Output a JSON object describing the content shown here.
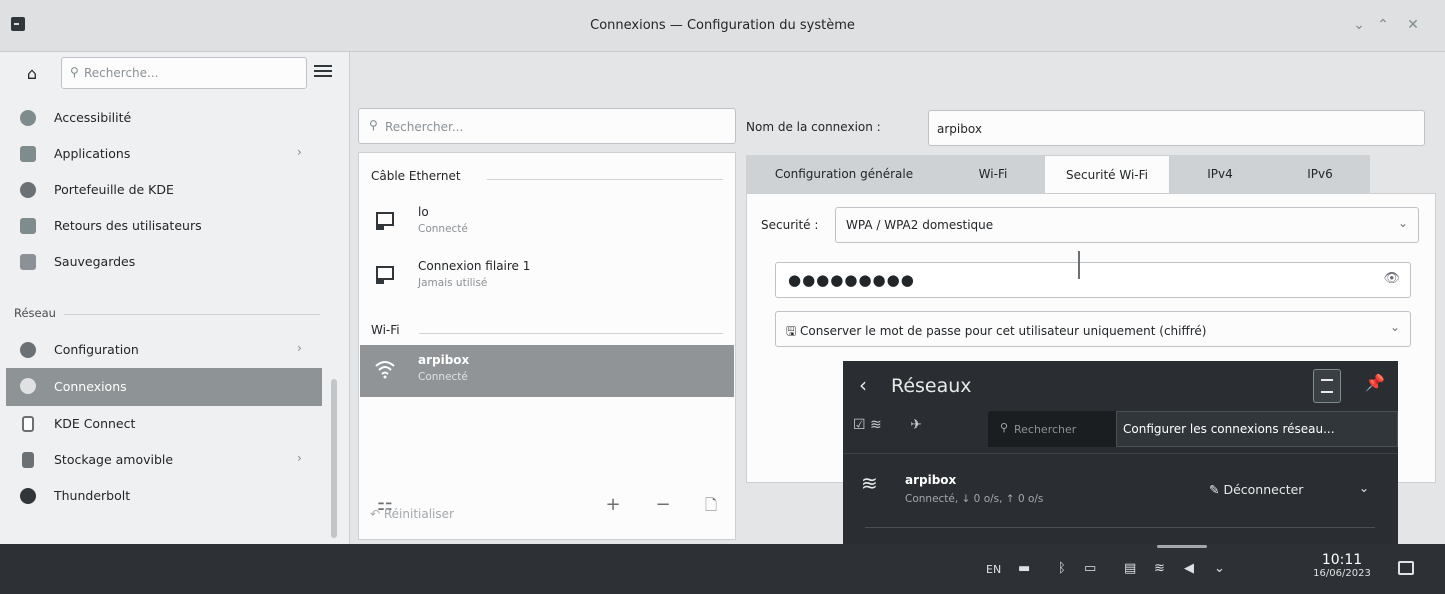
{
  "window": {
    "title": "Connexions — Configuration du système",
    "controls": [
      "chevron-down",
      "chevron-up",
      "close"
    ]
  },
  "sidebar": {
    "search_placeholder": "Recherche...",
    "items_top": [
      {
        "label": "Accessibilité",
        "icon": "accessibility-icon",
        "color": "#7f8c8d"
      },
      {
        "label": "Applications",
        "icon": "applications-icon",
        "color": "#7f8c8d",
        "has_children": true
      },
      {
        "label": "Portefeuille de KDE",
        "icon": "wallet-icon",
        "color": "#6b7074"
      },
      {
        "label": "Retours des utilisateurs",
        "icon": "feedback-icon",
        "color": "#7f8c8d"
      },
      {
        "label": "Sauvegardes",
        "icon": "backup-icon",
        "color": "#8b9196"
      }
    ],
    "section_label": "Réseau",
    "items_network": [
      {
        "label": "Configuration",
        "icon": "network-config-icon",
        "color": "#6b7074",
        "has_children": true
      },
      {
        "label": "Connexions",
        "icon": "connections-icon",
        "color": "#dfe1e3",
        "active": true
      },
      {
        "label": "KDE Connect",
        "icon": "kdeconnect-icon",
        "color": "#6b7074"
      },
      {
        "label": "Stockage amovible",
        "icon": "removable-storage-icon",
        "color": "#6b7074",
        "has_children": true
      },
      {
        "label": "Thunderbolt",
        "icon": "thunderbolt-icon",
        "color": "#31363b"
      }
    ]
  },
  "connections": {
    "search_placeholder": "Rechercher...",
    "groups": [
      {
        "label": "Câble Ethernet",
        "items": [
          {
            "name": "lo",
            "status": "Connecté",
            "icon": "ethernet-icon"
          },
          {
            "name": "Connexion filaire 1",
            "status": "Jamais utilisé",
            "icon": "ethernet-icon"
          }
        ]
      },
      {
        "label": "Wi-Fi",
        "items": [
          {
            "name": "arpibox",
            "status": "Connecté",
            "icon": "wifi-icon",
            "selected": true
          }
        ]
      }
    ],
    "reset_label": "Réinitialiser"
  },
  "detail": {
    "name_label": "Nom de la connexion :",
    "name_value": "arpibox",
    "tabs": [
      "Configuration générale",
      "Wi-Fi",
      "Securité Wi-Fi",
      "IPv4",
      "IPv6"
    ],
    "active_tab": 2,
    "security_label": "Securité :",
    "security_value": "WPA / WPA2 domestique",
    "password_mask": "●●●●●●●●●",
    "password_storage": "Conserver le mot de passe pour cet utilisateur uniquement (chiffré)"
  },
  "network_popup": {
    "title": "Réseaux",
    "search_placeholder": "Rechercher",
    "tooltip": "Configurer les connexions réseau...",
    "network": {
      "name": "arpibox",
      "status": "Connecté, ↓ 0 o/s, ↑ 0 o/s"
    },
    "disconnect_label": "Déconnecter"
  },
  "taskbar": {
    "keyboard_layout": "EN",
    "time": "10:11",
    "date": "16/06/2023"
  }
}
